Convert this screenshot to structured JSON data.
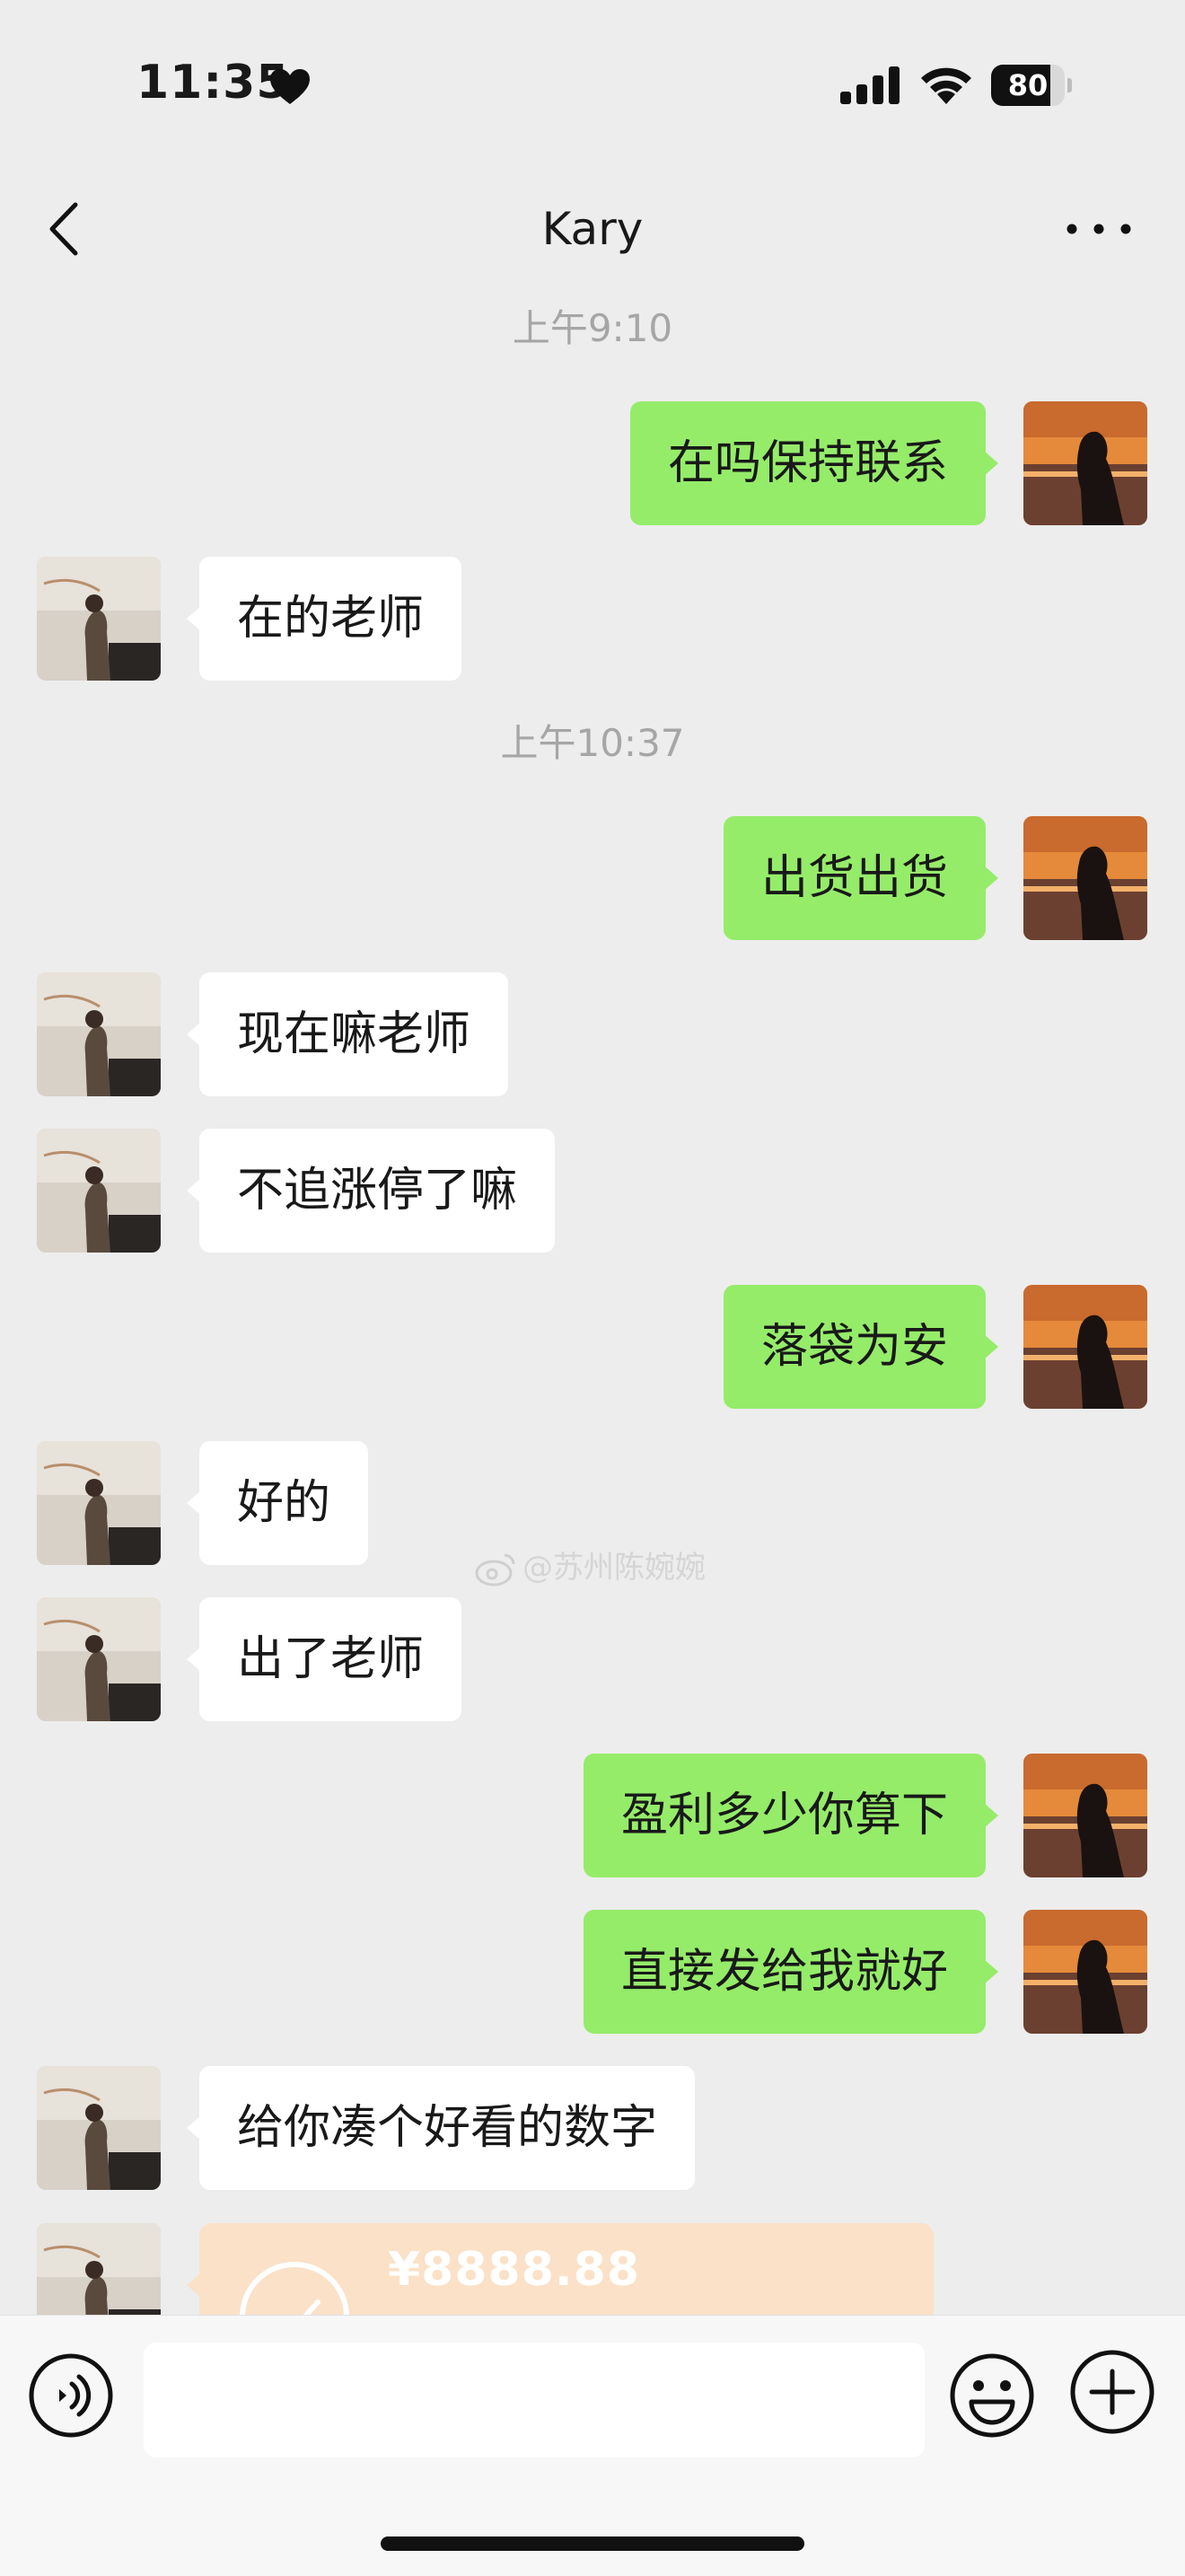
{
  "status_bar": {
    "time": "11:35",
    "heart_icon": "heart-icon",
    "signal_icon": "cellular-signal-icon",
    "wifi_icon": "wifi-icon",
    "battery_level": "80",
    "battery_fraction": 0.8
  },
  "header": {
    "title": "Kary",
    "back_icon": "chevron-left-icon",
    "more_icon": "more-dots-icon"
  },
  "messages": [
    {
      "type": "timestamp",
      "text": "上午9:10"
    },
    {
      "type": "message",
      "direction": "out",
      "text": "在吗保持联系"
    },
    {
      "type": "message",
      "direction": "in",
      "text": "在的老师"
    },
    {
      "type": "timestamp",
      "text": "上午10:37"
    },
    {
      "type": "message",
      "direction": "out",
      "text": "出货出货"
    },
    {
      "type": "message",
      "direction": "in",
      "text": "现在嘛老师"
    },
    {
      "type": "message",
      "direction": "in",
      "text": "不追涨停了嘛"
    },
    {
      "type": "message",
      "direction": "out",
      "text": "落袋为安"
    },
    {
      "type": "message",
      "direction": "in",
      "text": "好的"
    },
    {
      "type": "message",
      "direction": "in",
      "text": "出了老师"
    },
    {
      "type": "message",
      "direction": "out",
      "text": "盈利多少你算下"
    },
    {
      "type": "message",
      "direction": "out",
      "text": "直接发给我就好"
    },
    {
      "type": "message",
      "direction": "in",
      "text": "给你凑个好看的数字"
    },
    {
      "type": "transfer",
      "direction": "in",
      "amount": "¥8888.88"
    }
  ],
  "watermark": "@苏州陈婉婉",
  "input_bar": {
    "voice_icon": "voice-input-icon",
    "text_value": "",
    "emoji_icon": "emoji-icon",
    "plus_icon": "plus-circle-icon"
  },
  "colors": {
    "background": "#ededed",
    "incoming_bubble": "#ffffff",
    "outgoing_bubble": "#95ec69",
    "transfer_card": "#fbe1c7",
    "timestamp_text": "#a6a6a6"
  }
}
